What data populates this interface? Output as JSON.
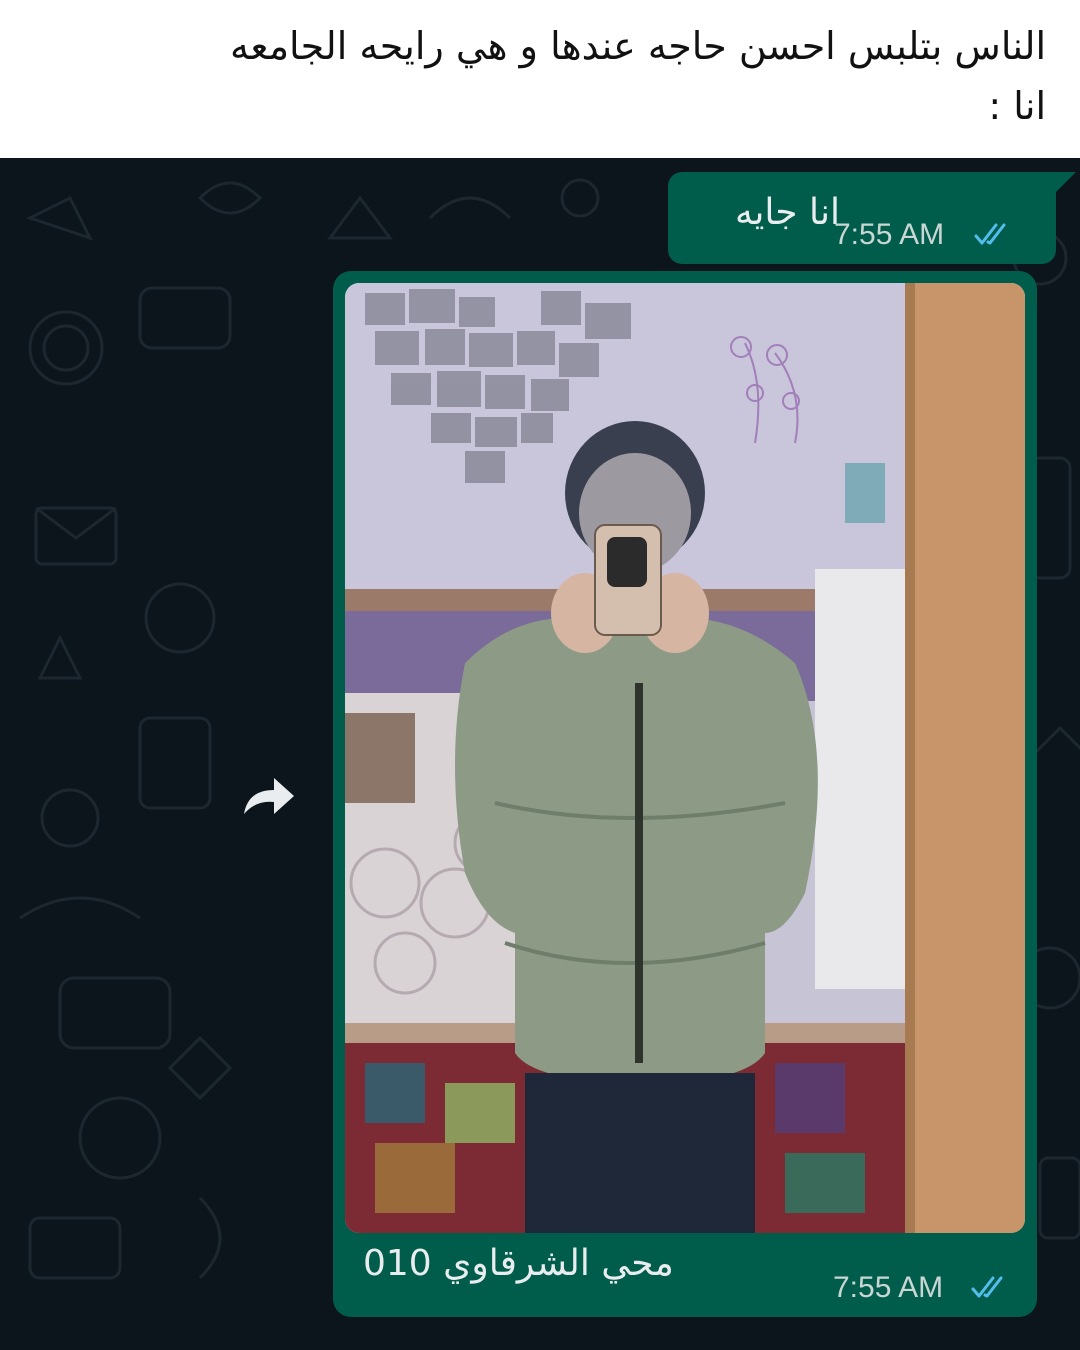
{
  "post_caption": {
    "line1": "الناس بتلبس احسن حاجه عندها و هي رايحه الجامعه",
    "line2": "انا :"
  },
  "chat": {
    "text_message": {
      "text": "انا جايه",
      "time": "7:55 AM",
      "status_icon": "double-check-read-icon"
    },
    "image_message": {
      "image_description_icon": "mirror-selfie-photo",
      "caption": "محي الشرقاوي 010",
      "time": "7:55 AM",
      "status_icon": "double-check-read-icon"
    },
    "forward_icon": "forward-arrow-icon"
  },
  "colors": {
    "chat_background": "#0c151b",
    "outgoing_bubble": "#005c4b",
    "read_ticks": "#53bdeb",
    "message_text": "#e9edef"
  }
}
